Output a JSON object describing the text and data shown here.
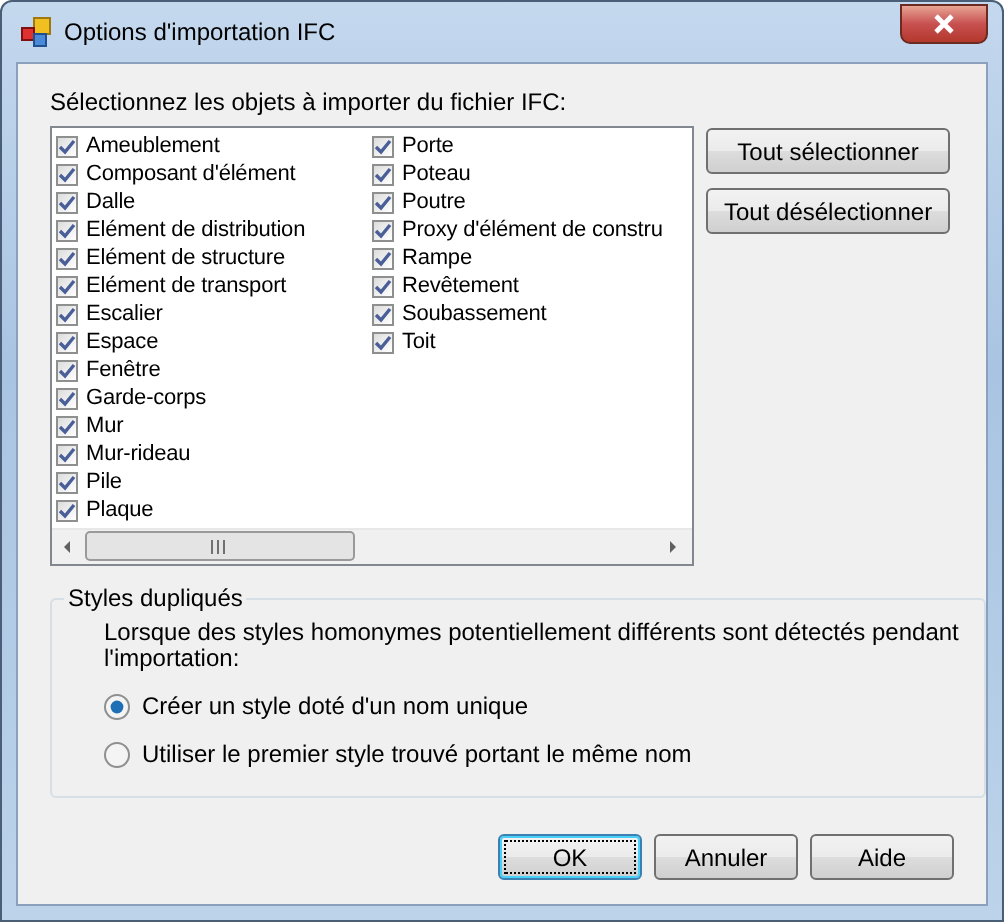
{
  "window": {
    "title": "Options d'importation IFC"
  },
  "objects": {
    "label": "Sélectionnez les objets à importer du fichier IFC:",
    "items": [
      {
        "label": "Ameublement",
        "checked": true
      },
      {
        "label": "Composant d'élément",
        "checked": true
      },
      {
        "label": "Dalle",
        "checked": true
      },
      {
        "label": "Elément de distribution",
        "checked": true
      },
      {
        "label": "Elément de structure",
        "checked": true
      },
      {
        "label": "Elément de transport",
        "checked": true
      },
      {
        "label": "Escalier",
        "checked": true
      },
      {
        "label": "Espace",
        "checked": true
      },
      {
        "label": "Fenêtre",
        "checked": true
      },
      {
        "label": "Garde-corps",
        "checked": true
      },
      {
        "label": "Mur",
        "checked": true
      },
      {
        "label": "Mur-rideau",
        "checked": true
      },
      {
        "label": "Pile",
        "checked": true
      },
      {
        "label": "Plaque",
        "checked": true
      },
      {
        "label": "Porte",
        "checked": true
      },
      {
        "label": "Poteau",
        "checked": true
      },
      {
        "label": "Poutre",
        "checked": true
      },
      {
        "label": "Proxy d'élément de constru",
        "checked": true
      },
      {
        "label": "Rampe",
        "checked": true
      },
      {
        "label": "Revêtement",
        "checked": true
      },
      {
        "label": "Soubassement",
        "checked": true
      },
      {
        "label": "Toit",
        "checked": true
      }
    ],
    "buttons": [
      "Tout sélectionner",
      "Tout désélectionner"
    ]
  },
  "duplicate_styles": {
    "title": "Styles dupliqués",
    "description": "Lorsque des styles homonymes potentiellement différents sont détectés pendant l'importation:",
    "options": [
      {
        "label": "Créer un style doté d'un nom unique",
        "selected": true
      },
      {
        "label": "Utiliser le premier style trouvé portant le même nom",
        "selected": false
      }
    ]
  },
  "buttons": [
    {
      "label": "OK",
      "default": true
    },
    {
      "label": "Annuler",
      "default": false
    },
    {
      "label": "Aide",
      "default": false
    }
  ]
}
